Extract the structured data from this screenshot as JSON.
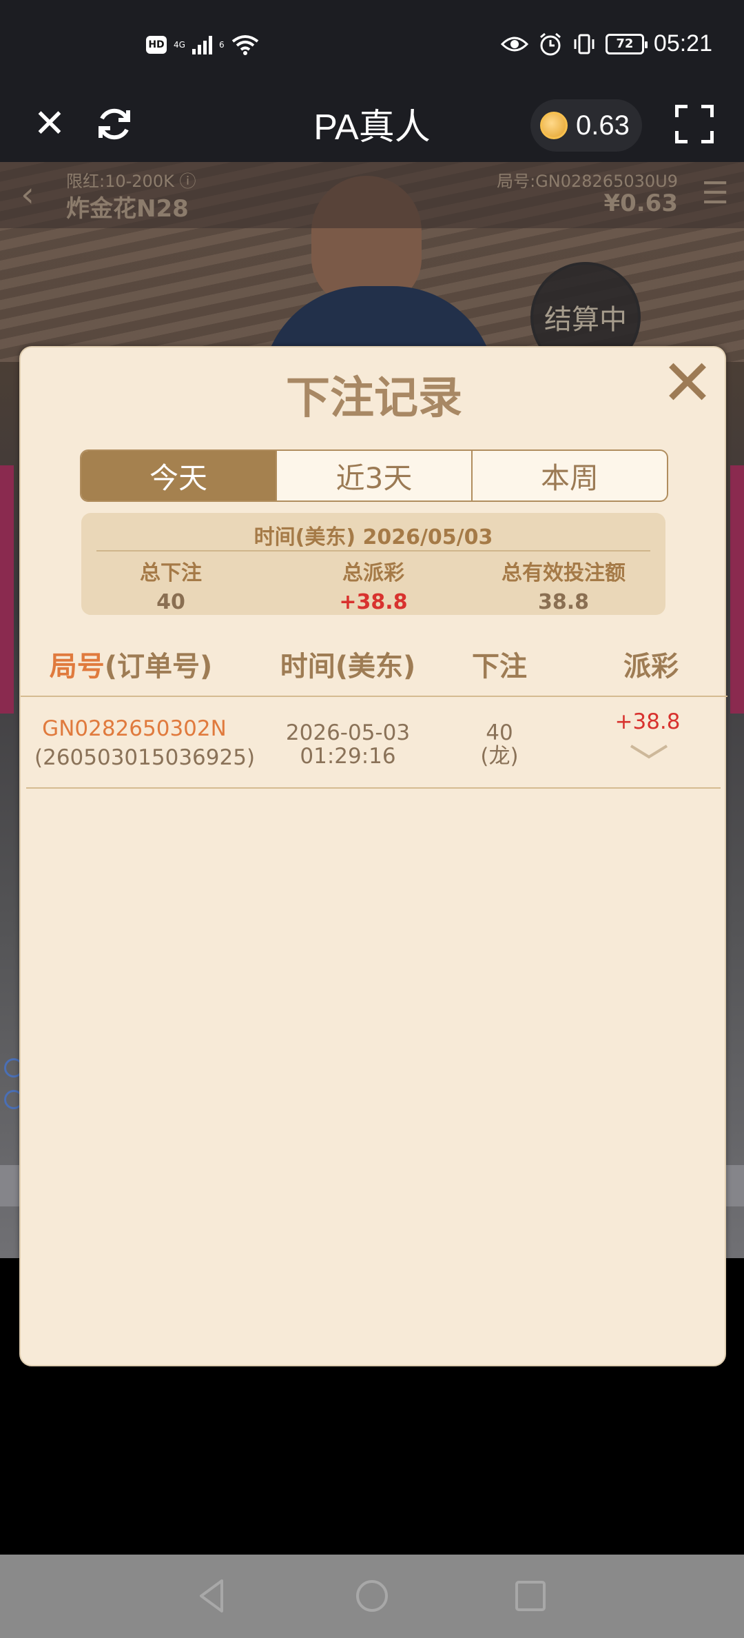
{
  "status_bar": {
    "hd": "HD",
    "signal_label": "4G",
    "wifi_label": "6",
    "battery": "72",
    "time": "05:21"
  },
  "app_bar": {
    "title": "PA真人",
    "wallet_balance": "0.63"
  },
  "game_info": {
    "limit": "限红:10-200K ⓘ",
    "name": "炸金花N28",
    "round": "局号:GN028265030U9",
    "balance": "¥0.63",
    "settle_status": "结算中"
  },
  "modal": {
    "title": "下注记录",
    "tabs": [
      {
        "label": "今天",
        "active": true
      },
      {
        "label": "近3天",
        "active": false
      },
      {
        "label": "本周",
        "active": false
      }
    ],
    "summary": {
      "date_label": "时间(美东) 2026/05/03",
      "total_bet_label": "总下注",
      "total_bet_value": "40",
      "total_payout_label": "总派彩",
      "total_payout_value": "+38.8",
      "valid_bet_label": "总有效投注额",
      "valid_bet_value": "38.8"
    },
    "table": {
      "headers": {
        "round_a": "局号",
        "round_b": "(订单号)",
        "time": "时间(美东)",
        "bet": "下注",
        "payout": "派彩"
      },
      "rows": [
        {
          "round_id": "GN0282650302N",
          "order_id": "(260503015036925)",
          "date": "2026-05-03",
          "time": "01:29:16",
          "bet": "40",
          "bet_on": "(龙)",
          "payout": "+38.8"
        }
      ]
    }
  },
  "colors": {
    "modal_bg": "#f7ead7",
    "tab_active": "#a5814f",
    "accent_orange": "#e07a3d",
    "accent_red": "#d8322e",
    "text_brown": "#9e7c54"
  }
}
